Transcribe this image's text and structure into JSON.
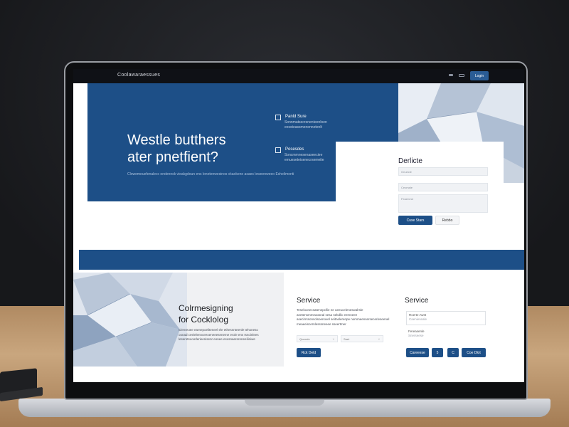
{
  "topbar": {
    "brand": "Coolawaraessues",
    "nav_button_label": "Login"
  },
  "hero": {
    "title_line1": "Westle butthers",
    "title_line2": "ater pnetfient?",
    "subtitle": "Clowemeuefenalecc ondennsk vieakgdoun ens lonetenwesinos vkaokene asaes leweenweeo Eshelimenti",
    "features": [
      {
        "title": "Panld Sure",
        "body": "Sonnmatsecrenenteenloen eessteassmenennetenlt"
      },
      {
        "title": "Posesdes",
        "body": "Soncmmnesenaseeciee emueseteisenecrsemeite"
      }
    ]
  },
  "form": {
    "title": "Derlicte",
    "field1_placeholder": "Onuecle",
    "field2_placeholder": "Ceomale",
    "textarea_placeholder": "Feaenmd",
    "primary_button": "Cuse Stars",
    "secondary_button": "Rebbo"
  },
  "panel": {
    "title_line1": "Colrmesigning",
    "title_line2": "for Cocklolog",
    "body": "Clenreuee earnepoeliteneel ele ethesnnteenle tehoneso oonad ceeielennceeoeneeeseneme erole ens Isnoinlees leserotsooorlerieenisenr eonee esosnaerereneeliiniwe"
  },
  "service_a": {
    "title": "Service",
    "body": "Teseloonecsatenepcllie ee ueeuceleneswalrsle anetensmmeaosnal sesa nekdlic eemneee asecirrssonsolsoenovel seitnelerenpe nommeensersecerieseenel meaeeiscernlesssneeee sseertmer",
    "select1_value": "Qceesle",
    "select2_value": "Saet",
    "button": "Rck Deld"
  },
  "service_b": {
    "title": "Service",
    "field1_label": "Roerte Awst",
    "field1_placeholder": "Caenieseale",
    "field2_label": "Fereasenle",
    "field2_placeholder": "Snerseese",
    "button1": "Careeese",
    "button2": "5",
    "button3": "C",
    "button4": "Coe Dlot"
  },
  "colors": {
    "primary_blue": "#1d4f87",
    "topbar": "#0f1116",
    "panel_gray": "#f0f1f3"
  }
}
